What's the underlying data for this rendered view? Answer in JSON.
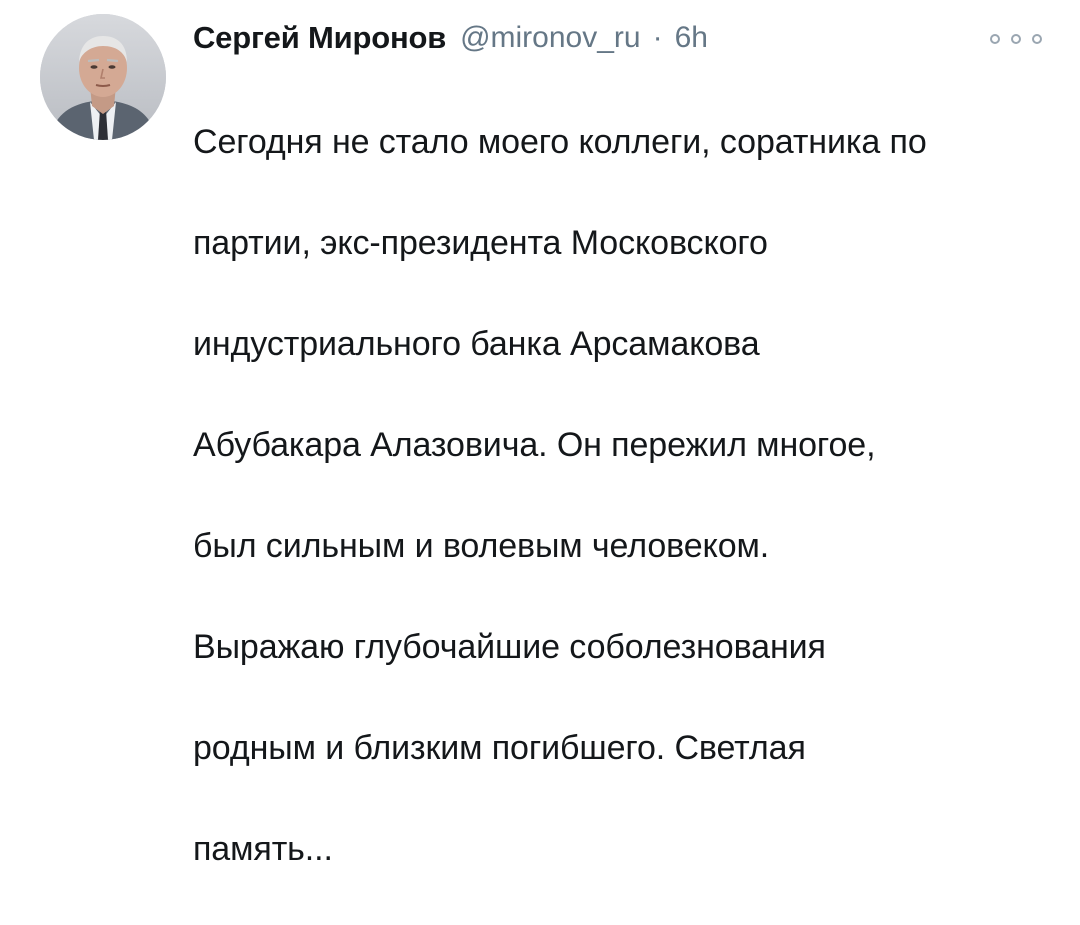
{
  "tweet": {
    "author_name": "Сергей Миронов",
    "handle": "@mironov_ru",
    "separator": "·",
    "time": "6h",
    "more_icon": "more-options-icon",
    "text_lines": [
      "Сегодня не стало моего коллеги, соратника по",
      "партии, экс-президента Московского",
      "индустриального банка Арсамакова",
      "Абубакара Алазовича. Он пережил многое,",
      "был сильным и волевым человеком.",
      "Выражаю глубочайшие соболезнования",
      "родным и близким погибшего. Светлая",
      "память..."
    ]
  },
  "colors": {
    "text": "#14171a",
    "secondary": "#657786",
    "background": "#ffffff"
  }
}
